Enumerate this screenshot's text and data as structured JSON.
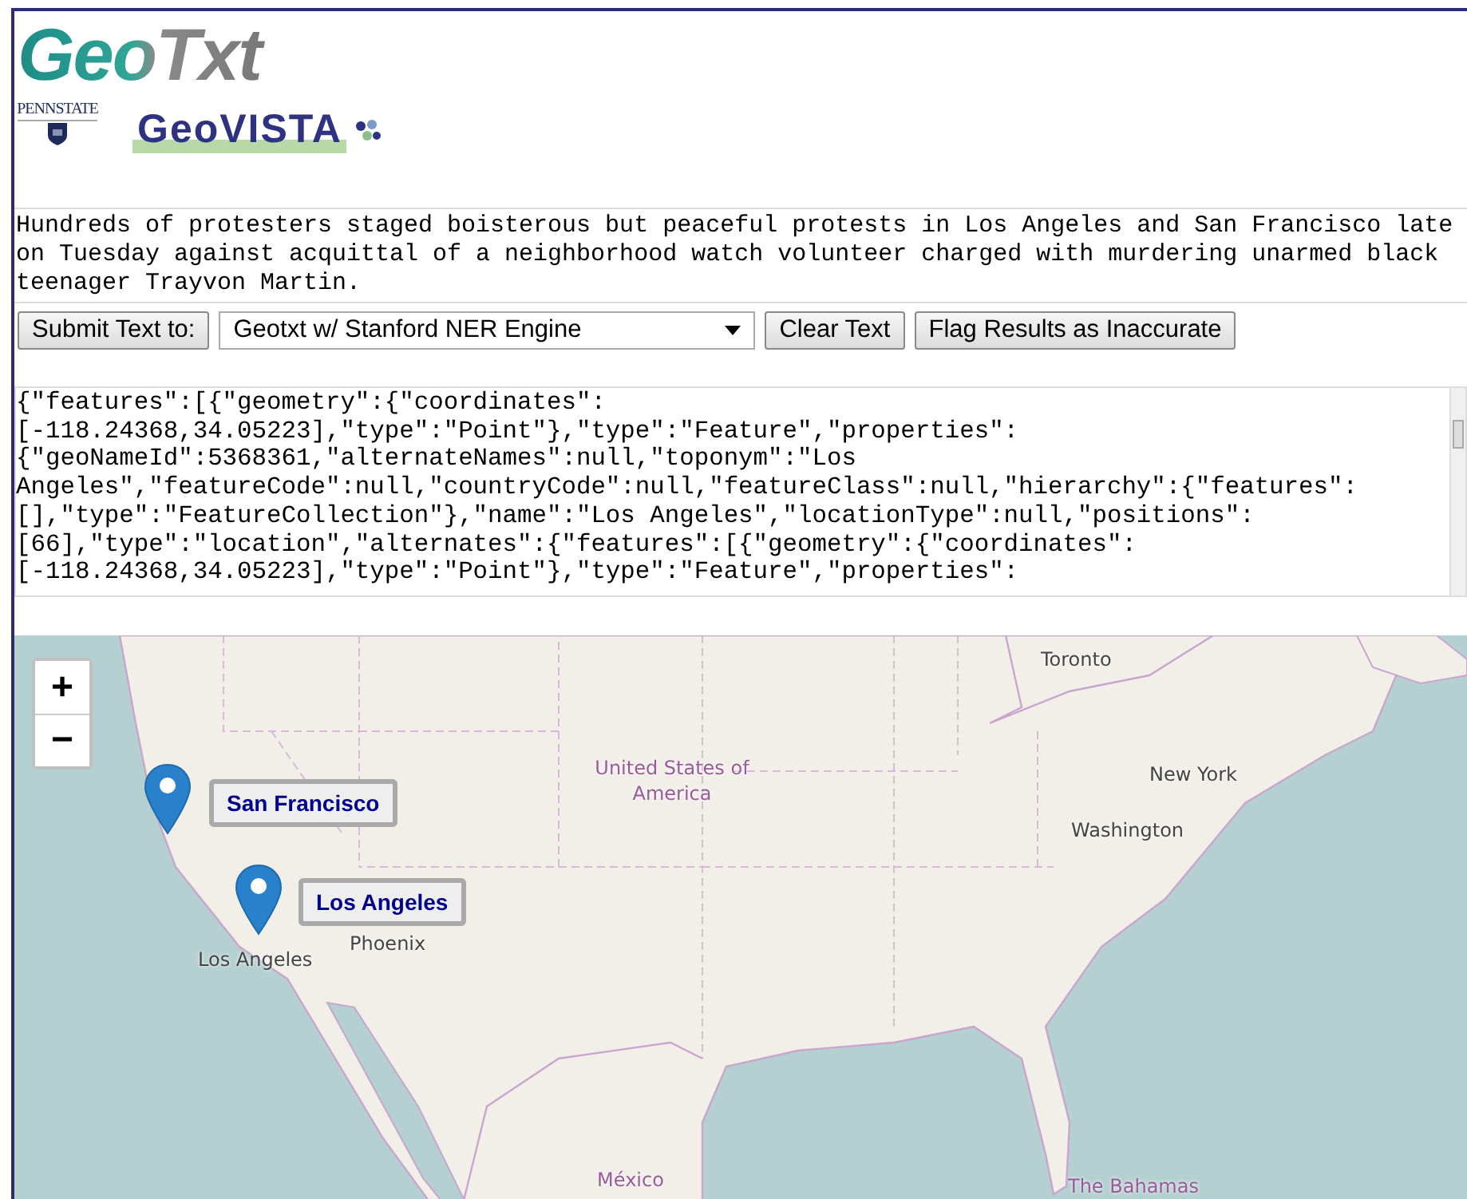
{
  "header": {
    "app_logo": "GeoTxt",
    "university_logo": "PENNSTATE",
    "lab_logo": "GeoVISTA"
  },
  "input_text": {
    "value": "Hundreds of protesters staged boisterous but peaceful protests in Los Angeles and San Francisco late on Tuesday against acquittal of a neighborhood watch volunteer charged with murdering unarmed black teenager Trayvon Martin."
  },
  "toolbar": {
    "submit_button": "Submit Text to:",
    "engine_select": "Geotxt w/ Stanford NER Engine",
    "clear_button": "Clear Text",
    "flag_button": "Flag Results as Inaccurate"
  },
  "output": {
    "lines": [
      "{\"features\":[{\"geometry\":{\"coordinates\":",
      "[-118.24368,34.05223],\"type\":\"Point\"},\"type\":\"Feature\",\"properties\":",
      "{\"geoNameId\":5368361,\"alternateNames\":null,\"toponym\":\"Los",
      "Angeles\",\"featureCode\":null,\"countryCode\":null,\"featureClass\":null,\"hierarchy\":{\"features\":",
      "[],\"type\":\"FeatureCollection\"},\"name\":\"Los Angeles\",\"locationType\":null,\"positions\":",
      "[66],\"type\":\"location\",\"alternates\":{\"features\":[{\"geometry\":{\"coordinates\":",
      "[-118.24368,34.05223],\"type\":\"Point\"},\"type\":\"Feature\",\"properties\":"
    ]
  },
  "map": {
    "zoom_in": "+",
    "zoom_out": "−",
    "markers": [
      {
        "label": "San Francisco"
      },
      {
        "label": "Los Angeles"
      }
    ],
    "place_labels": [
      {
        "text": "Toronto",
        "kind": "city"
      },
      {
        "text": "New York",
        "kind": "city"
      },
      {
        "text": "Washington",
        "kind": "capital"
      },
      {
        "text": "United States of America",
        "kind": "country"
      },
      {
        "text": "Phoenix",
        "kind": "city"
      },
      {
        "text": "Los Angeles",
        "kind": "city"
      },
      {
        "text": "México",
        "kind": "country"
      },
      {
        "text": "The Bahamas",
        "kind": "country"
      }
    ]
  }
}
